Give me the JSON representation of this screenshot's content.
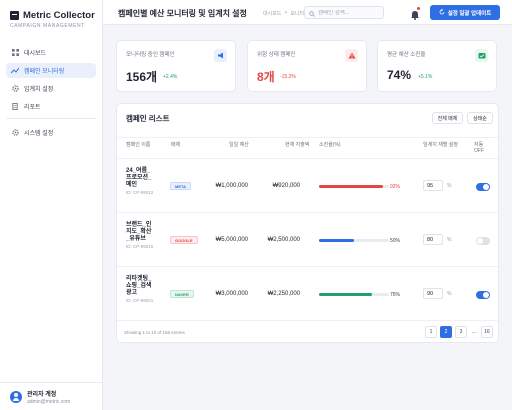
{
  "app": {
    "name": "Metric Collector",
    "subtitle": "CAMPAIGN MANAGEMENT"
  },
  "sidebar": {
    "items": [
      {
        "label": "대시보드",
        "icon": "grid-icon"
      },
      {
        "label": "캠페인 모니터링",
        "icon": "chart-icon",
        "active": true
      },
      {
        "label": "임계치 설정",
        "icon": "gear-icon"
      },
      {
        "label": "리포트",
        "icon": "document-icon"
      }
    ],
    "settings_label": "시스템 설정"
  },
  "profile": {
    "name": "관리자 계정",
    "email": "admin@metric.com"
  },
  "header": {
    "title": "캠페인별 예산 모니터링 및 임계치 설정",
    "breadcrumb": [
      "대시보드",
      "모니터링"
    ],
    "search_placeholder": "캠페인 검색...",
    "update_button": "설정 일괄 업데이트"
  },
  "colors": {
    "accent": "#2f6fe4",
    "danger": "#e64545",
    "success": "#22a06b"
  },
  "stats": [
    {
      "label": "모니터링 중인 캠페인",
      "value": "156개",
      "trend": "+2.4%",
      "trend_color": "#22a06b",
      "icon": "megaphone-icon"
    },
    {
      "label": "위험 상태 캠페인",
      "value": "8개",
      "value_color": "#e64545",
      "trend": "-15.2%",
      "trend_color": "#e64545",
      "icon": "warning-icon"
    },
    {
      "label": "평균 예산 소진율",
      "value": "74%",
      "trend": "+5.1%",
      "trend_color": "#22a06b",
      "icon": "wallet-icon"
    }
  ],
  "campaign_list": {
    "title": "캠페인 리스트",
    "filter_all": "전체 매체",
    "filter_status": "상태순",
    "columns": [
      "캠페인 이름",
      "매체",
      "일일 예산",
      "현재 지출액",
      "소진율(%)",
      "임계치 재별 설정",
      "자동 OFF"
    ],
    "rows": [
      {
        "name": "24_여름_프로모션_메인",
        "id": "ID: CP-99012",
        "media": "META",
        "budget": "₩1,000,000",
        "spend": "₩920,000",
        "burn": 92,
        "burn_label": "92%",
        "threshold": "95",
        "auto_off": true
      },
      {
        "name": "브랜드_인지도_확산_유튜브",
        "id": "ID: CP-99015",
        "media": "GOOGLE",
        "budget": "₩5,000,000",
        "spend": "₩2,500,000",
        "burn": 50,
        "burn_label": "50%",
        "threshold": "80",
        "auto_off": false
      },
      {
        "name": "리타겟팅_쇼핑_검색광고",
        "id": "ID: CP-99021",
        "media": "NAVER",
        "budget": "₩3,000,000",
        "spend": "₩2,250,000",
        "burn": 75,
        "burn_label": "75%",
        "threshold": "90",
        "auto_off": true
      }
    ],
    "percent_unit": "%",
    "footer": "Showing 1 to 10 of 156 entries",
    "pages": [
      "1",
      "2",
      "3",
      "...",
      "16"
    ],
    "current_page": "2"
  }
}
